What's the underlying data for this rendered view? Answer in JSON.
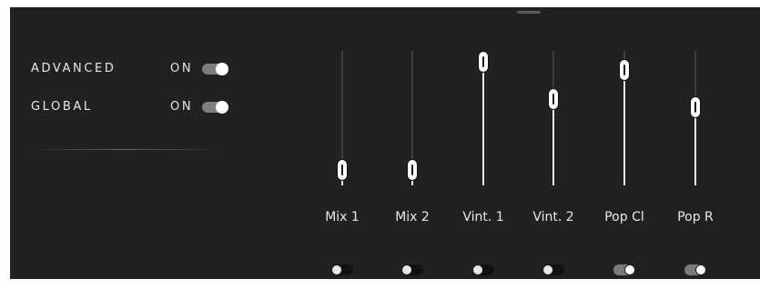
{
  "global_toggles": [
    {
      "label": "ADVANCED",
      "state": "ON",
      "on": true
    },
    {
      "label": "GLOBAL",
      "state": "ON",
      "on": true
    }
  ],
  "faders": [
    {
      "label": "Mix 1",
      "level": 0.04,
      "switch_on": false
    },
    {
      "label": "Mix 2",
      "level": 0.04,
      "switch_on": false
    },
    {
      "label": "Vint. 1",
      "level": 1.0,
      "switch_on": false
    },
    {
      "label": "Vint. 2",
      "level": 0.67,
      "switch_on": false
    },
    {
      "label": "Pop Cl",
      "level": 0.93,
      "switch_on": true
    },
    {
      "label": "Pop R",
      "level": 0.6,
      "switch_on": true
    }
  ],
  "colors": {
    "panel_bg": "#212121",
    "text": "#e8e8e8",
    "track": "#3d3d3d",
    "fill": "#e6e6e6",
    "switch_on": "#7a7a7a",
    "switch_off": "#111111"
  }
}
